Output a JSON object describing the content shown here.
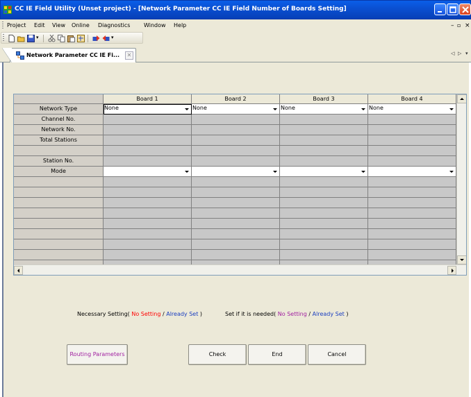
{
  "window": {
    "title": "CC IE Field Utility (Unset project) - [Network Parameter CC IE Field Number of Boards Setting]"
  },
  "menu": [
    "Project",
    "Edit",
    "View",
    "Online",
    "Diagnostics",
    "Window",
    "Help"
  ],
  "document_tab": {
    "label": "Network Parameter CC IE Fi..."
  },
  "grid": {
    "columns": [
      "Board 1",
      "Board 2",
      "Board 3",
      "Board 4"
    ],
    "rows": [
      "Network Type",
      "Channel No.",
      "Network No.",
      "Total Stations",
      "",
      "Station No.",
      "Mode"
    ],
    "network_type_values": [
      "None",
      "None",
      "None",
      "None"
    ]
  },
  "legend": {
    "necessary_prefix": "Necessary Setting(",
    "necessary_no": "No Setting",
    "sep1": "/",
    "necessary_set": "Already Set",
    "necessary_suffix": ")",
    "optional_prefix": "Set if it is needed(",
    "optional_no": "No Setting",
    "sep2": "/",
    "optional_set": "Already Set",
    "optional_suffix": ")"
  },
  "buttons": {
    "routing": "Routing Parameters",
    "check": "Check",
    "end": "End",
    "cancel": "Cancel"
  },
  "colors": {
    "no_setting_necessary": "#ff0000",
    "already_set": "#1a3ec0",
    "no_setting_optional": "#a020a0"
  }
}
